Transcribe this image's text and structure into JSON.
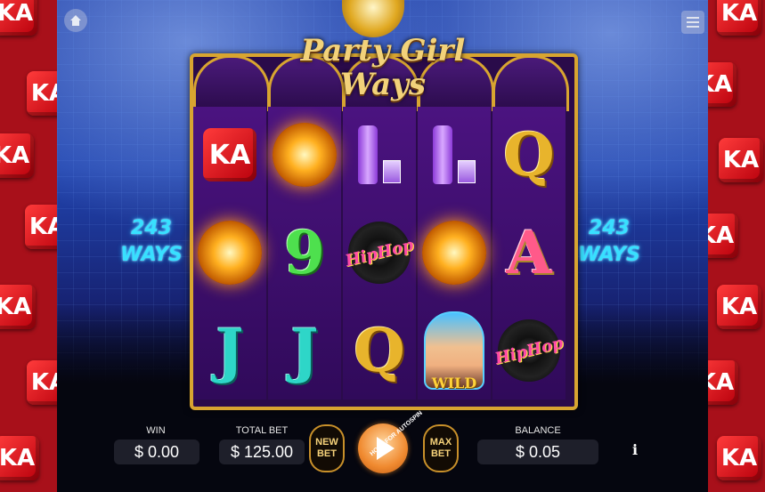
{
  "title": {
    "line1": "Party Girl",
    "line2": "Ways"
  },
  "ways": {
    "left": "243\nWAYS",
    "right": "243\nWAYS",
    "count": "243",
    "label": "WAYS"
  },
  "reels": [
    [
      "KA",
      "disco",
      "J"
    ],
    [
      "disco",
      "9",
      "J"
    ],
    [
      "whiskey",
      "hiphop",
      "Q"
    ],
    [
      "whiskey",
      "disco",
      "wild"
    ],
    [
      "Q",
      "A",
      "hiphop"
    ]
  ],
  "symbol_text": {
    "ka": "KA",
    "whiskey": "Whiskey",
    "hiphop": "HipHop",
    "wild": "WILD"
  },
  "win": {
    "label": "WIN",
    "value": "$ 0.00"
  },
  "total_bet": {
    "label": "TOTAL BET",
    "value": "$ 125.00"
  },
  "new_bet": {
    "label": "NEW\nBET",
    "l1": "NEW",
    "l2": "BET"
  },
  "max_bet": {
    "label": "MAX\nBET",
    "l1": "MAX",
    "l2": "BET"
  },
  "spin": {
    "hint": "HOLD FOR AUTOSPIN"
  },
  "balance": {
    "label": "BALANCE",
    "value": "$ 0.05"
  },
  "info": {
    "label": "i"
  },
  "colors": {
    "accent_gold": "#d8a530",
    "ways_cyan": "#38e0ff",
    "dice_red": "#e01020",
    "spin_orange": "#f08a30"
  },
  "icons": {
    "home": "home-icon",
    "menu": "menu-icon",
    "info": "info-icon",
    "spin": "play-icon"
  }
}
